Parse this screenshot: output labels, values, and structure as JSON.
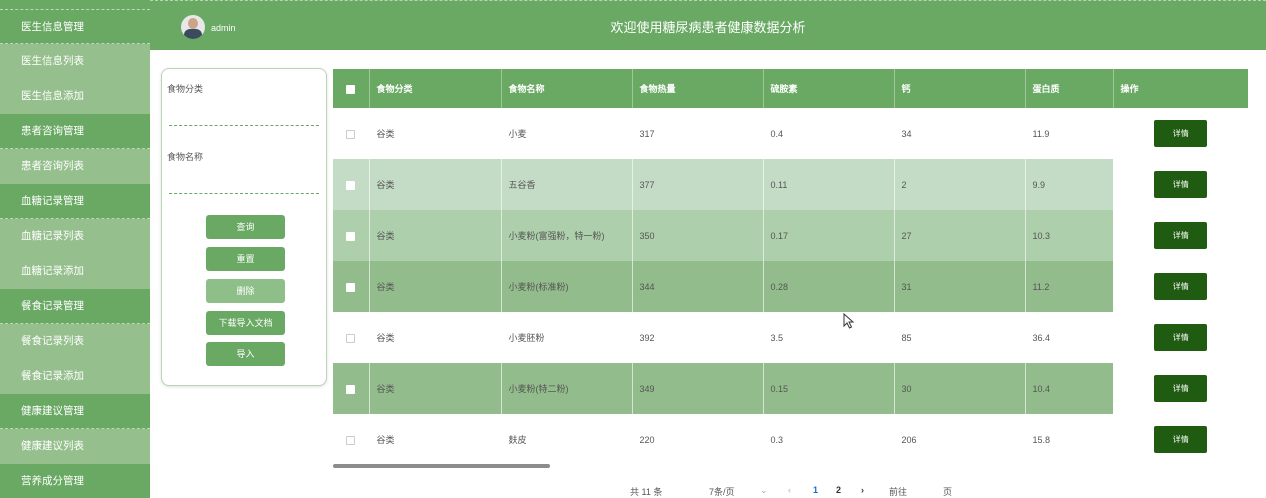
{
  "sidebar": {
    "items": [
      {
        "label": "医生信息管理",
        "type": "group"
      },
      {
        "label": "医生信息列表",
        "type": "sub"
      },
      {
        "label": "医生信息添加",
        "type": "sub"
      },
      {
        "label": "患者咨询管理",
        "type": "group"
      },
      {
        "label": "患者咨询列表",
        "type": "sub"
      },
      {
        "label": "血糖记录管理",
        "type": "group"
      },
      {
        "label": "血糖记录列表",
        "type": "sub"
      },
      {
        "label": "血糖记录添加",
        "type": "sub"
      },
      {
        "label": "餐食记录管理",
        "type": "group"
      },
      {
        "label": "餐食记录列表",
        "type": "sub"
      },
      {
        "label": "餐食记录添加",
        "type": "sub"
      },
      {
        "label": "健康建议管理",
        "type": "group"
      },
      {
        "label": "健康建议列表",
        "type": "sub"
      },
      {
        "label": "营养成分管理",
        "type": "group"
      }
    ]
  },
  "header": {
    "username": "admin",
    "title": "欢迎使用糖尿病患者健康数据分析"
  },
  "search": {
    "category_label": "食物分类",
    "category_value": "",
    "name_label": "食物名称",
    "name_value": "",
    "query_button": "查询",
    "reset_button": "重置",
    "delete_button": "删除",
    "download_template_button": "下载导入文档",
    "import_button": "导入"
  },
  "table": {
    "columns": [
      "食物分类",
      "食物名称",
      "食物热量",
      "硫胺素",
      "钙",
      "蛋白质",
      "操作"
    ],
    "detail_label": "详情",
    "rows": [
      {
        "category": "谷类",
        "name": "小麦",
        "calories": "317",
        "thiamine": "0.4",
        "calcium": "34",
        "protein": "11.9"
      },
      {
        "category": "谷类",
        "name": "五谷香",
        "calories": "377",
        "thiamine": "0.11",
        "calcium": "2",
        "protein": "9.9"
      },
      {
        "category": "谷类",
        "name": "小麦粉(富强粉，特一粉)",
        "calories": "350",
        "thiamine": "0.17",
        "calcium": "27",
        "protein": "10.3"
      },
      {
        "category": "谷类",
        "name": "小麦粉(标准粉)",
        "calories": "344",
        "thiamine": "0.28",
        "calcium": "31",
        "protein": "11.2"
      },
      {
        "category": "谷类",
        "name": "小麦胚粉",
        "calories": "392",
        "thiamine": "3.5",
        "calcium": "85",
        "protein": "36.4"
      },
      {
        "category": "谷类",
        "name": "小麦粉(特二粉)",
        "calories": "349",
        "thiamine": "0.15",
        "calcium": "30",
        "protein": "10.4"
      },
      {
        "category": "谷类",
        "name": "麸皮",
        "calories": "220",
        "thiamine": "0.3",
        "calcium": "206",
        "protein": "15.8"
      }
    ]
  },
  "pagination": {
    "total": "共 11 条",
    "page_size": "7条/页",
    "prev": "‹",
    "pages": [
      "1",
      "2"
    ],
    "next": "›",
    "goto_label": "前往",
    "page_unit": "页",
    "current_page": 1
  },
  "colors": {
    "primary": "#6aa964",
    "detail_button": "#1f5c12",
    "active_page": "#1e6ad2"
  }
}
